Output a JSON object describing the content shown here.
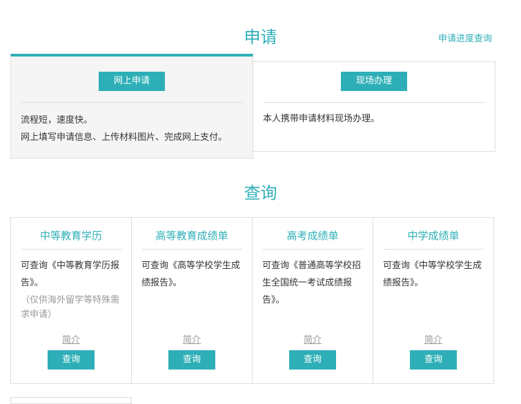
{
  "apply": {
    "title": "申请",
    "progress_link": "申请进度查询",
    "online": {
      "button": "网上申请",
      "lines": [
        "流程短，速度快。",
        "网上填写申请信息、上传材料图片、完成网上支付。"
      ]
    },
    "onsite": {
      "button": "现场办理",
      "lines": [
        "本人携带申请材料现场办理。"
      ]
    }
  },
  "query": {
    "title": "查询",
    "cards": [
      {
        "title": "中等教育学历",
        "desc": "可查询《中等教育学历报告》。",
        "note": "（仅供海外留学等特殊需求申请）",
        "intro": "简介",
        "button": "查询"
      },
      {
        "title": "高等教育成绩单",
        "desc": "可查询《高等学校学生成绩报告》。",
        "intro": "简介",
        "button": "查询"
      },
      {
        "title": "高考成绩单",
        "desc": "可查询《普通高等学校招生全国统一考试成绩报告》。",
        "intro": "简介",
        "button": "查询"
      },
      {
        "title": "中学成绩单",
        "desc": "可查询《中等学校学生成绩报告》。",
        "intro": "简介",
        "button": "查询"
      }
    ]
  },
  "colors": {
    "accent": "#2eafb7"
  }
}
